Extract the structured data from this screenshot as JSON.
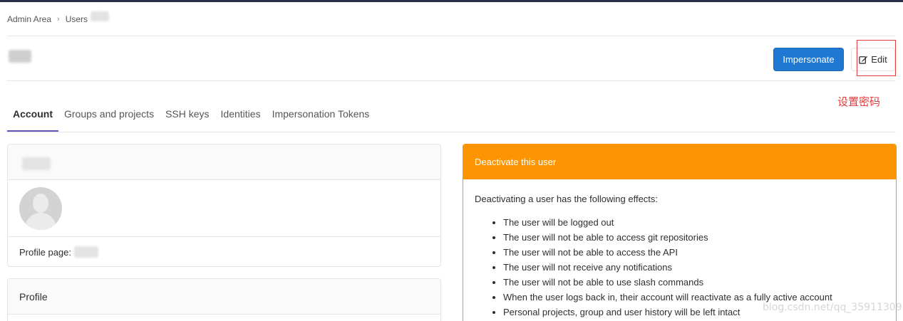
{
  "breadcrumb": {
    "items": [
      "Admin Area",
      "Users"
    ]
  },
  "header": {
    "impersonate_label": "Impersonate",
    "edit_label": "Edit"
  },
  "annotation": {
    "label": "设置密码"
  },
  "tabs": [
    {
      "label": "Account",
      "active": true
    },
    {
      "label": "Groups and projects",
      "active": false
    },
    {
      "label": "SSH keys",
      "active": false
    },
    {
      "label": "Identities",
      "active": false
    },
    {
      "label": "Impersonation Tokens",
      "active": false
    }
  ],
  "account_card": {
    "profile_page_label": "Profile page:"
  },
  "profile_card": {
    "title": "Profile"
  },
  "deactivate_card": {
    "title": "Deactivate this user",
    "intro": "Deactivating a user has the following effects:",
    "effects": [
      "The user will be logged out",
      "The user will not be able to access git repositories",
      "The user will not be able to access the API",
      "The user will not receive any notifications",
      "The user will not be able to use slash commands",
      "When the user logs back in, their account will reactivate as a fully active account",
      "Personal projects, group and user history will be left intact"
    ]
  },
  "watermark": "blog.csdn.net/qq_35911309",
  "colors": {
    "primary": "#1f78d1",
    "warning": "#fc9403",
    "tab_active": "#6b4fbb",
    "annotation": "#e23b3b"
  }
}
